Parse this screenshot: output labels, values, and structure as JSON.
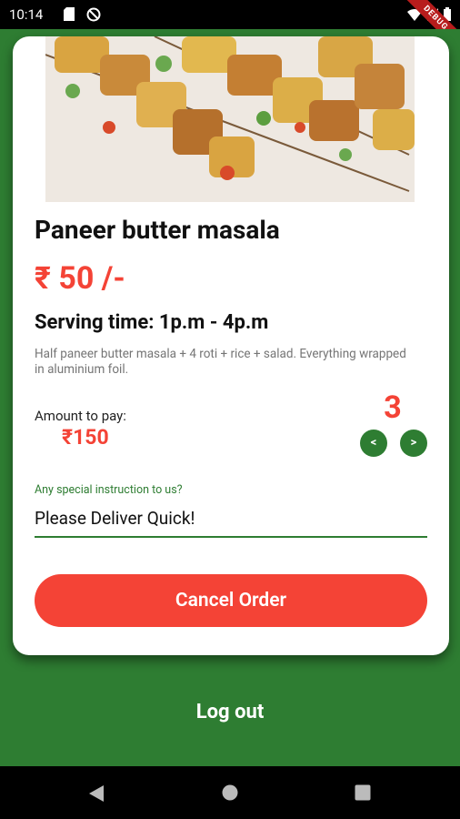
{
  "status_bar": {
    "time": "10:14",
    "debug_label": "DEBUG"
  },
  "dish": {
    "name": "Paneer butter masala",
    "price": "₹ 50 /-",
    "serving_time": "Serving time: 1p.m - 4p.m",
    "description": "Half paneer butter masala + 4 roti + rice + salad. Everything wrapped in aluminium foil."
  },
  "order": {
    "amount_label": "Amount to pay:",
    "amount_value": "₹150",
    "quantity": "3",
    "decrement_label": "<",
    "increment_label": ">"
  },
  "instructions": {
    "label": "Any special instruction to us?",
    "value": "Please Deliver Quick!"
  },
  "actions": {
    "cancel_label": "Cancel Order",
    "logout_label": "Log out"
  },
  "colors": {
    "primary_green": "#2e7d32",
    "accent_red": "#f44336"
  }
}
